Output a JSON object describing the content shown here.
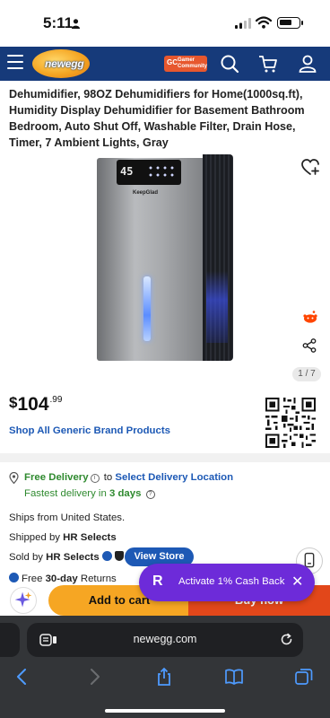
{
  "status": {
    "time": "5:11"
  },
  "header": {
    "logo_text": "newegg",
    "gamer_community_label": "Gamer\nCommunity",
    "gamer_community_logo": "GC"
  },
  "product": {
    "title": "Dehumidifier, 98OZ Dehumidifiers for Home(1000sq.ft), Humidity Display Dehumidifier for Basement Bathroom Bedroom, Auto Shut Off, Washable Filter, Drain Hose, Timer, 7 Ambient Lights, Gray",
    "image_display": "45",
    "image_brand": "KeepGlad",
    "image_pager": "1 / 7",
    "price_currency": "$",
    "price_dollars": "104",
    "price_cents": ".99",
    "shop_all": "Shop All Generic Brand Products"
  },
  "delivery": {
    "free_delivery": "Free Delivery",
    "to": "to",
    "select_location": "Select Delivery Location",
    "fastest_prefix": "Fastest delivery in",
    "fastest_days": "3 days"
  },
  "seller": {
    "ships_from": "Ships from United States.",
    "shipped_by_prefix": "Shipped by",
    "shipped_by": "HR Selects",
    "sold_by_prefix": "Sold by",
    "sold_by": "HR Selects",
    "view_store": "View Store",
    "returns_prefix": "Free",
    "returns_days": "30-day",
    "returns_suffix": "Returns"
  },
  "cta": {
    "add_to_cart": "Add to cart",
    "buy_now": "Buy now"
  },
  "cashback": {
    "logo": "R",
    "label": "Activate 1% Cash Back",
    "close": "✕"
  },
  "browser": {
    "url": "newegg.com"
  },
  "colors": {
    "header_bg": "#163a7a",
    "link_blue": "#1d59b5",
    "delivery_green": "#2f8a2f",
    "cart_orange": "#f6a623",
    "buy_red": "#e2471a",
    "cashback_purple": "#6d2bd9"
  }
}
